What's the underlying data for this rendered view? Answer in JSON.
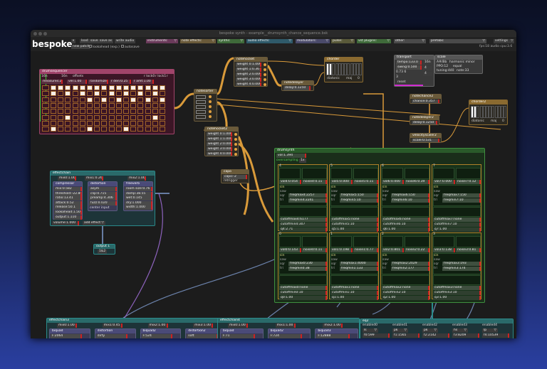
{
  "window": {
    "title": "bespoke synth - example__drumsynth_chance_sequence.bsk"
  },
  "header": {
    "logo": "bespoke",
    "buttons": [
      "load",
      "save",
      "save as",
      "write audio",
      "new patch"
    ],
    "checkboxes": [
      "lookahead (exp.)",
      "autosave"
    ],
    "menus": [
      {
        "label": "instruments:",
        "color": "#6a3a5a"
      },
      {
        "label": "note effects:",
        "color": "#6a5a3a"
      },
      {
        "label": "synths:",
        "color": "#3f6a3a"
      },
      {
        "label": "audio effects:",
        "color": "#2f5a6a"
      },
      {
        "label": "modulators:",
        "color": "#4a4a6a"
      },
      {
        "label": "pulse:",
        "color": "#5a5a3a"
      },
      {
        "label": "vst plugins:",
        "color": "#3f6a3a"
      },
      {
        "label": "other:",
        "color": "#4a4a4a"
      },
      {
        "label": "prefabs:",
        "color": "#4a4a4a"
      }
    ],
    "settings": "settings",
    "status": "fps:18  audio cpu:3.6"
  },
  "colors": {
    "note": "#d99a3a",
    "audio": "#7f9ccf",
    "modulation": "#9a6acf",
    "sequencer": "#a0446a",
    "synth": "#3f8f3f",
    "effect": "#2a8a8a"
  },
  "drumsequencer": {
    "title": "drumsequencer",
    "controls": [
      "16n",
      "16n",
      "offsets",
      "r lock0",
      "r lock1",
      "r"
    ],
    "row2": [
      "measures:2",
      "vel:1.00",
      "randomize",
      "r den:0.25",
      "r amt:1.00"
    ],
    "grid": [
      [
        1,
        1,
        1,
        1,
        1,
        1,
        1,
        1,
        1,
        1,
        1,
        1,
        1,
        1,
        1,
        1,
        1,
        1,
        1,
        1,
        1,
        1,
        1,
        1,
        1,
        1,
        1,
        1,
        1,
        1,
        1,
        1
      ],
      [
        1,
        0,
        0,
        0,
        1,
        0,
        0,
        0,
        1,
        0,
        0,
        0,
        1,
        0,
        0,
        0,
        1,
        0,
        0,
        0,
        1,
        0,
        0,
        0,
        1,
        0,
        0,
        0,
        1,
        0,
        0,
        0
      ],
      [
        0,
        1,
        0,
        0,
        0,
        1,
        0,
        0,
        0,
        0,
        1,
        0,
        0,
        0,
        1,
        0,
        0,
        0,
        1,
        0,
        0,
        0,
        1,
        0,
        0,
        0,
        1,
        0,
        0,
        0,
        1,
        0
      ],
      [
        0,
        0,
        0,
        0,
        0,
        0,
        0,
        0,
        0,
        0,
        0,
        0,
        0,
        0,
        0,
        0,
        0,
        0,
        0,
        0,
        0,
        0,
        0,
        0,
        0,
        0,
        0,
        0,
        0,
        0,
        0,
        0
      ],
      [
        0,
        0,
        0,
        0,
        0,
        0,
        0,
        0,
        0,
        0,
        0,
        0,
        0,
        0,
        0,
        0,
        0,
        0,
        0,
        0,
        0,
        0,
        0,
        0,
        0,
        0,
        0,
        0,
        0,
        0,
        0,
        0
      ],
      [
        0,
        0,
        0,
        0,
        1,
        0,
        0,
        0,
        0,
        0,
        0,
        0,
        0,
        0,
        0,
        0,
        0,
        0,
        0,
        0,
        0,
        0,
        0,
        0,
        0,
        0,
        0,
        0,
        1,
        0,
        0,
        0
      ],
      [
        0,
        0,
        0,
        0,
        0,
        0,
        0,
        0,
        0,
        0,
        0,
        0,
        0,
        0,
        0,
        0,
        0,
        0,
        0,
        0,
        0,
        0,
        0,
        0,
        0,
        0,
        0,
        0,
        0,
        0,
        0,
        0
      ],
      [
        1,
        0,
        0,
        0,
        0,
        0,
        0,
        1,
        0,
        0,
        1,
        0,
        0,
        0,
        0,
        0,
        0,
        0,
        0,
        0,
        1,
        0,
        0,
        0,
        0,
        1,
        0,
        0,
        0,
        0,
        0,
        0
      ]
    ]
  },
  "notesorter": {
    "title": "notesorter"
  },
  "notehocket": {
    "title": "notehocket",
    "weights": [
      "weight 0:1.000",
      "weight 1:0.367",
      "weight 2:0.000",
      "weight 3:0.000",
      "weight 4:0.000"
    ]
  },
  "notehocket2": {
    "title": "notehocket2",
    "weights": [
      "weight 0:1.000",
      "weight 1:1.000",
      "weight 2:0.000",
      "weight 3:0.000",
      "weight 4:0.000"
    ]
  },
  "notedelayer": {
    "title": "notedelayer",
    "delay": "delay:0.1250"
  },
  "chorder": {
    "title": "chorder",
    "diatonic": "diatonic",
    "mode": "maj",
    "value": "0"
  },
  "chorder2": {
    "title": "chorder2",
    "diatonic": "diatonic",
    "mode": "maj",
    "value": "0"
  },
  "transport": {
    "title": "transport",
    "tempo": "tempo:133.0",
    "swing": "swing:0.500",
    "position": "0.73 6",
    "measure": "3",
    "reset": "reset",
    "options": [
      "16n",
      "4",
      "4"
    ]
  },
  "scale": {
    "title": "scale",
    "root": "A#/Bb",
    "type": "harmonic minor",
    "ppo": "PPO:12",
    "tuning_mode": "equal",
    "tuning": "tuning:440",
    "note": "note:33"
  },
  "notechance2": {
    "title": "notechance2",
    "chance": "chance:0.357"
  },
  "notedelayer2": {
    "title": "notedelayer2",
    "delay": "delay:0.1250"
  },
  "velocityscaler2": {
    "title": "velocityscaler2",
    "scale": "scale:0.531"
  },
  "capo": {
    "title": "capo",
    "capo": "capo:-2",
    "retrigger": "retrigger"
  },
  "drumsynth": {
    "title": "drumsynth",
    "vol": "vol:1.394",
    "oversampling": "oversampling",
    "oversampling_value": "1x",
    "cells": [
      {
        "id": "4",
        "vol": "vol4:0.054",
        "noise": "noise4:0.11",
        "wave": [
          "sin",
          "saw",
          "sqr",
          "tri"
        ],
        "freqmax": "freqmax4:2257",
        "freqmin": "freqmin4:2241",
        "cutoffmax": "cutoffmax4:6177",
        "cutoffmin": "cutoffmin4:307",
        "q": "q4:2.71"
      },
      {
        "id": "5",
        "vol": "vol5:0.000",
        "noise": "noise5:0.11",
        "wave": [
          "sin",
          "saw",
          "sqr",
          "tri"
        ],
        "freqmax": "freqmax5:150",
        "freqmin": "freqmin5:10",
        "cutoffmax": "cutoffmax5:none",
        "cutoffmin": "cutoffmin5:10",
        "q": "q5:1.00"
      },
      {
        "id": "6",
        "vol": "vol6:0.000",
        "noise": "noise6:0.39",
        "wave": [
          "sin",
          "saw",
          "sqr",
          "tri"
        ],
        "freqmax": "freqmax6:150",
        "freqmin": "freqmin6:10",
        "cutoffmax": "cutoffmax6:none",
        "cutoffmin": "cutoffmin6:10",
        "q": "q6:1.00"
      },
      {
        "id": "7",
        "vol": "vol7:0.000",
        "noise": "noise7:0.12",
        "wave": [
          "sin",
          "saw",
          "sqr",
          "tri"
        ],
        "freqmax": "freqmax7:150",
        "freqmin": "freqmin7:10",
        "cutoffmax": "cutoffmax7:none",
        "cutoffmin": "cutoffmin7:10",
        "q": "q7:1.00"
      },
      {
        "id": "0",
        "vol": "vol0:0.143",
        "noise": "noise0:0.11",
        "wave": [
          "sin",
          "saw",
          "sqr",
          "tri"
        ],
        "freqmax": "freqmax0:230",
        "freqmin": "freqmin0:38",
        "cutoffmax": "cutoffmax0:none",
        "cutoffmin": "cutoffmin0:10",
        "q": "q0:1.00"
      },
      {
        "id": "1",
        "vol": "vol1:0.198",
        "noise": "noise1:0.77",
        "wave": [
          "sin",
          "saw",
          "sqr",
          "tri"
        ],
        "freqmax": "freqmax1:4000",
        "freqmin": "freqmin1:133",
        "cutoffmax": "cutoffmax1:none",
        "cutoffmin": "cutoffmin1:10",
        "q": "q1:1.00"
      },
      {
        "id": "2",
        "vol": "vol2:0.801",
        "noise": "noise2:0.22",
        "wave": [
          "sin",
          "saw",
          "sqr",
          "tri"
        ],
        "freqmax": "freqmax2:2029",
        "freqmin": "freqmin2:177",
        "cutoffmax": "cutoffmax2:none",
        "cutoffmin": "cutoffmin2:10",
        "q": "q2:1.00"
      },
      {
        "id": "3",
        "vol": "vol3:0.138",
        "noise": "noise3:0.81",
        "wave": [
          "sin",
          "saw",
          "sqr",
          "tri"
        ],
        "freqmax": "freqmax3:193",
        "freqmin": "freqmin3:174",
        "cutoffmax": "cutoffmax3:none",
        "cutoffmin": "cutoffmin3:10",
        "q": "q3:1.00"
      }
    ]
  },
  "effectchain": {
    "title": "effectchain",
    "mix": [
      "mix0:1.00",
      "mix1:0.26",
      "mix2:1.00"
    ],
    "compressor": {
      "title": "compressor",
      "rows": [
        "mix:0.582",
        "threshold:-22.86",
        "ratio:13.41",
        "attack:0.52",
        "release:50.1",
        "lookahead:1.50",
        "output:1.110"
      ]
    },
    "distortion": {
      "title": "distortion",
      "rows": [
        "asym",
        "clip:0.715",
        "preamp:4.306",
        "fuzz:0.020"
      ],
      "center": "center input"
    },
    "freeverb": {
      "title": "freeverb",
      "rows": [
        "room size:0.76",
        "damp:38.55",
        "wet:0.145",
        "dry:1.000",
        "width:1.000"
      ]
    },
    "volume": "volume:1.000",
    "add_effect": "add effect:"
  },
  "output": {
    "title": "output 1",
    "channels": "1&2"
  },
  "effectchain3": {
    "title": "effectchain3",
    "mix": [
      "mix0:1.00",
      "mix1:0.45",
      "mix2:1.00",
      "mix3:1.00"
    ],
    "effects": [
      {
        "title": "biquad",
        "value": "F:2064"
      },
      {
        "title": "distortion",
        "value": "dirty"
      },
      {
        "title": "biquad2",
        "value": "F:524"
      },
      {
        "title": "distortion2",
        "value": "soft"
      }
    ]
  },
  "effectchain4": {
    "title": "effectchain4",
    "mix": [
      "mix0:1.00",
      "mix1:1.00",
      "mix2:1.00"
    ],
    "effects": [
      {
        "title": "biquad",
        "value": "F:71"
      },
      {
        "title": "biquad2",
        "value": "F:724"
      },
      {
        "title": "biquad3",
        "value": "F:12888"
      }
    ]
  },
  "eq2": {
    "title": "eq2",
    "bands": [
      {
        "enabled": "enabled0",
        "type": "ls",
        "f": "f0:599"
      },
      {
        "enabled": "enabled1",
        "type": "pk",
        "f": "f1:1565"
      },
      {
        "enabled": "enabled2",
        "type": "pk",
        "f": "f2:2142"
      },
      {
        "enabled": "enabled3",
        "type": "hs",
        "f": "f3:8209"
      },
      {
        "enabled": "enabled4",
        "type": "lp",
        "f": "f4:10539"
      }
    ]
  }
}
